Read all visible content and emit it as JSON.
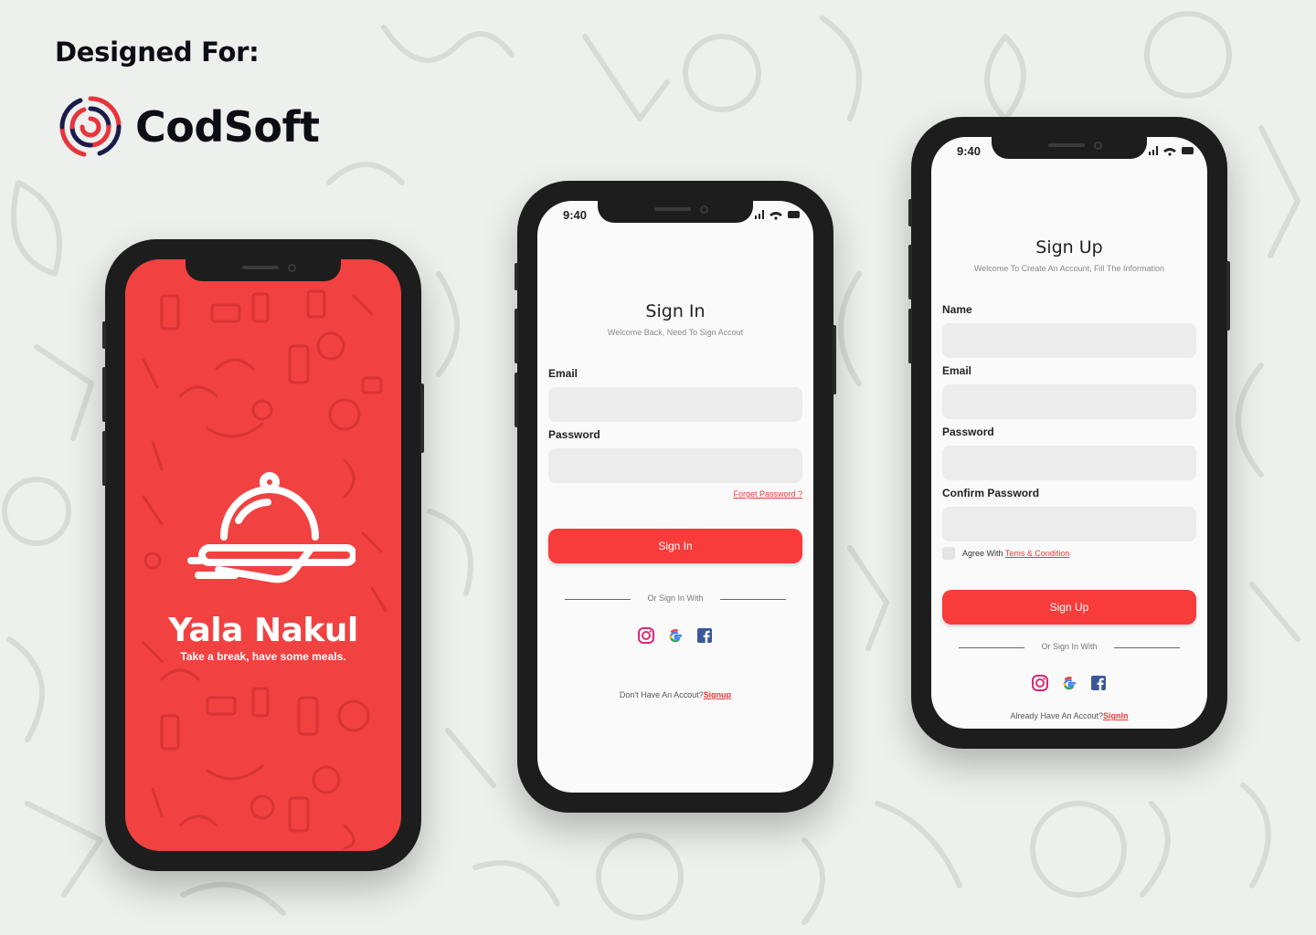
{
  "branding": {
    "designed_for": "Designed For:",
    "company": "CodSoft"
  },
  "colors": {
    "accent": "#f83b3b",
    "splash_bg": "#f24141",
    "link": "#e83a3a",
    "input_bg": "#ececec"
  },
  "status_bar": {
    "time": "9:40"
  },
  "splash": {
    "app_name": "Yala Nakul",
    "tagline": "Take a break, have some meals."
  },
  "signin": {
    "title": "Sign In",
    "subtitle": "Welcome Back, Need To Sign Accout",
    "email_label": "Email",
    "password_label": "Password",
    "forgot_password": "Forget Password ?",
    "submit_label": "Sign In",
    "divider_text": "Or Sign In With",
    "social_icons": [
      "instagram-icon",
      "google-icon",
      "facebook-icon"
    ],
    "no_account_text": "Don't Have An Accout?",
    "signup_link": "Signup"
  },
  "signup": {
    "title": "Sign Up",
    "subtitle": "Welcome To Create An Account, Fill The Information",
    "name_label": "Name",
    "email_label": "Email",
    "password_label": "Password",
    "confirm_password_label": "Confirm Password",
    "agree_text": "Agree With",
    "terms_link": "Tems & Condition",
    "submit_label": "Sign Up",
    "divider_text": "Or Sign In With",
    "social_icons": [
      "instagram-icon",
      "google-icon",
      "facebook-icon"
    ],
    "have_account_text": "Already Have An Accout?",
    "signin_link": "SignIn"
  }
}
